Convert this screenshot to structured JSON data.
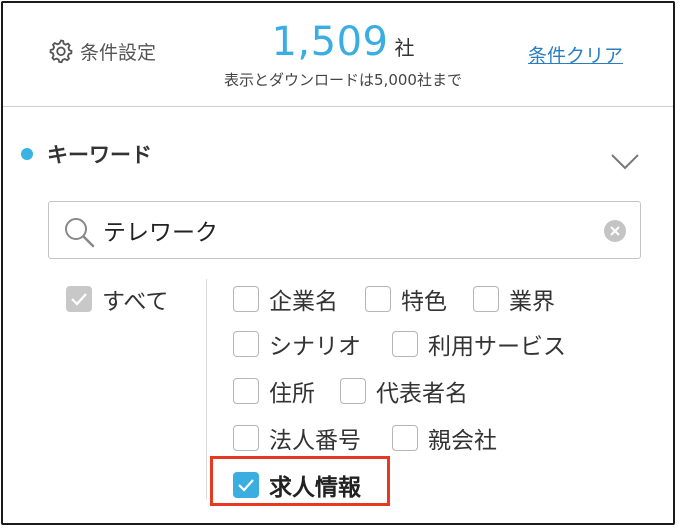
{
  "header": {
    "settings_label": "条件設定",
    "count_value": "1,509",
    "count_unit": "社",
    "count_note": "表示とダウンロードは5,000社まで",
    "clear_label": "条件クリア"
  },
  "keyword": {
    "title": "キーワード",
    "search_value": "テレワーク",
    "all_label": "すべて",
    "options": [
      {
        "label": "企業名",
        "checked": false
      },
      {
        "label": "特色",
        "checked": false
      },
      {
        "label": "業界",
        "checked": false
      },
      {
        "label": "シナリオ",
        "checked": false
      },
      {
        "label": "利用サービス",
        "checked": false
      },
      {
        "label": "住所",
        "checked": false
      },
      {
        "label": "代表者名",
        "checked": false
      },
      {
        "label": "法人番号",
        "checked": false
      },
      {
        "label": "親会社",
        "checked": false
      },
      {
        "label": "求人情報",
        "checked": true
      }
    ]
  },
  "colors": {
    "accent": "#3aaee0",
    "link": "#2a7fc2",
    "highlight_border": "#e8381f"
  }
}
